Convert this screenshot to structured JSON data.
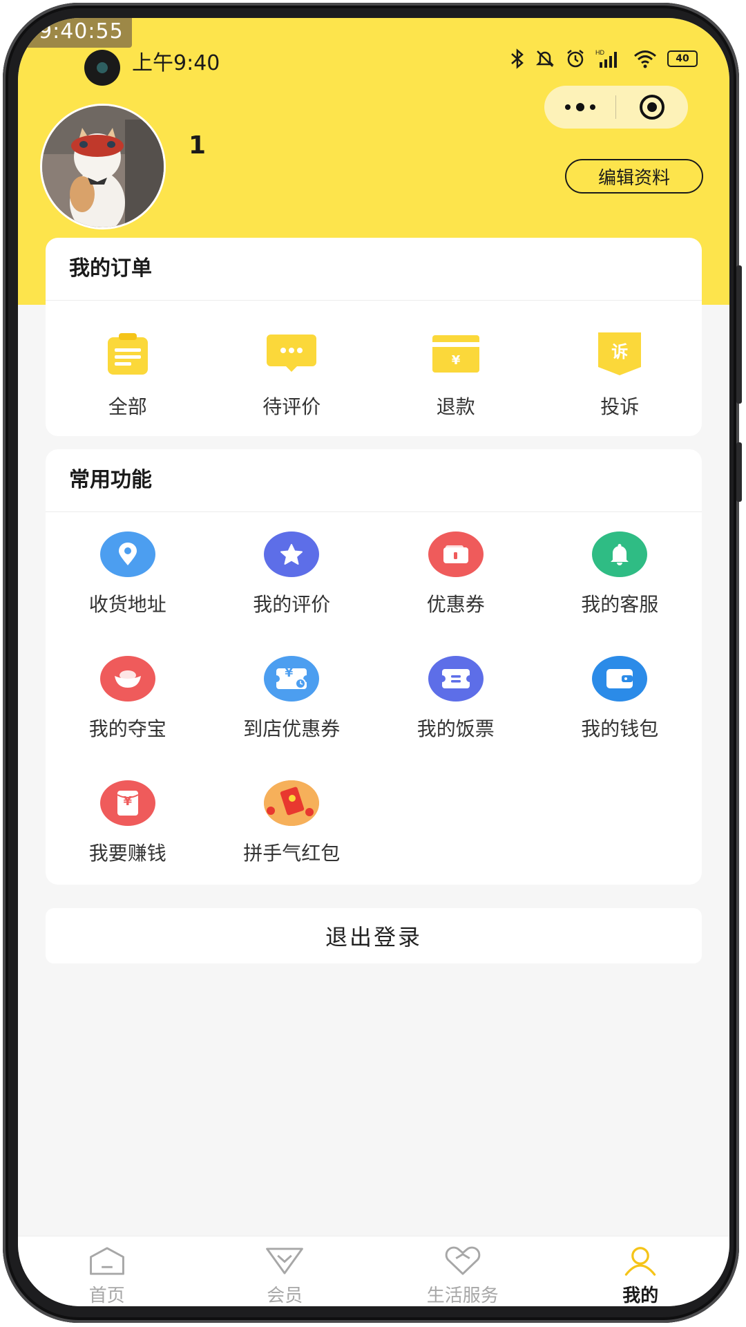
{
  "recorder_time": "9:40:55",
  "status_bar": {
    "time": "上午9:40",
    "battery": "40",
    "network": "HD"
  },
  "capsule": {
    "more_icon": "more-dots-icon",
    "close_icon": "target-icon"
  },
  "profile": {
    "name": "1",
    "edit_label": "编辑资料"
  },
  "orders": {
    "title": "我的订单",
    "items": [
      {
        "label": "全部",
        "icon": "clipboard-icon"
      },
      {
        "label": "待评价",
        "icon": "comment-icon"
      },
      {
        "label": "退款",
        "icon": "refund-icon"
      },
      {
        "label": "投诉",
        "icon": "complaint-icon",
        "icon_text": "诉"
      }
    ]
  },
  "functions": {
    "title": "常用功能",
    "items": [
      {
        "label": "收货地址",
        "icon": "location-icon",
        "color": "#4c9ef0"
      },
      {
        "label": "我的评价",
        "icon": "star-icon",
        "color": "#5d6ee8"
      },
      {
        "label": "优惠券",
        "icon": "coupon-icon",
        "color": "#ef5b5b"
      },
      {
        "label": "我的客服",
        "icon": "bell-icon",
        "color": "#2fbc84"
      },
      {
        "label": "我的夺宝",
        "icon": "treasure-icon",
        "color": "#ef5b5b"
      },
      {
        "label": "到店优惠券",
        "icon": "store-coupon-icon",
        "color": "#4c9ef0",
        "icon_text": "¥"
      },
      {
        "label": "我的饭票",
        "icon": "meal-ticket-icon",
        "color": "#5d6ee8"
      },
      {
        "label": "我的钱包",
        "icon": "wallet-icon",
        "color": "#2b8be8"
      },
      {
        "label": "我要赚钱",
        "icon": "earn-money-icon",
        "color": "#ef5b5b",
        "icon_text": "¥"
      },
      {
        "label": "拼手气红包",
        "icon": "red-packet-icon",
        "color": "#f4a24c"
      }
    ]
  },
  "logout_label": "退出登录",
  "tabbar": {
    "items": [
      {
        "label": "首页",
        "icon": "home-icon"
      },
      {
        "label": "会员",
        "icon": "member-icon"
      },
      {
        "label": "生活服务",
        "icon": "heart-service-icon"
      },
      {
        "label": "我的",
        "icon": "profile-icon",
        "active": true
      }
    ]
  },
  "colors": {
    "brand_yellow": "#fde44c",
    "icon_yellow": "#fbd83a"
  }
}
